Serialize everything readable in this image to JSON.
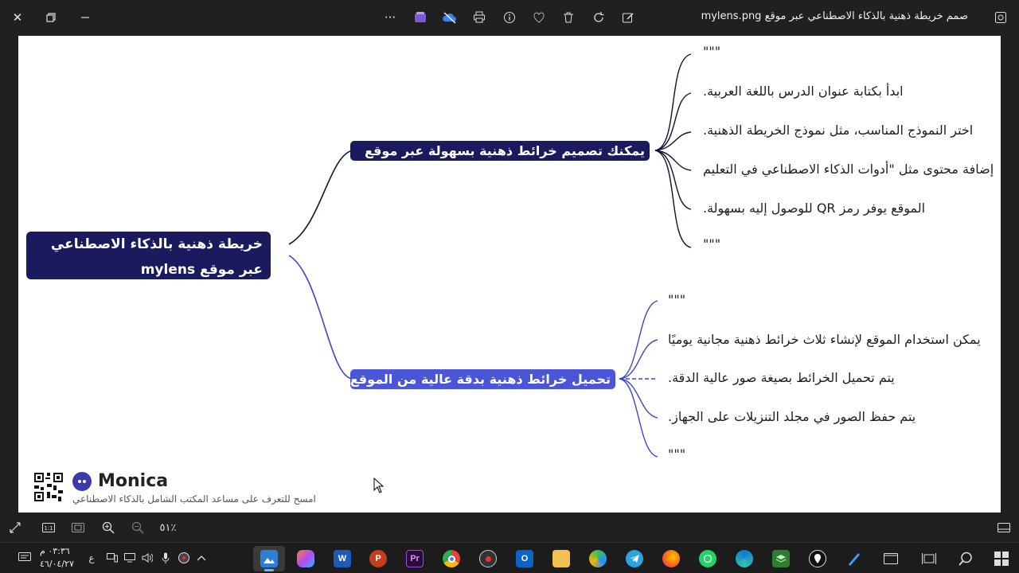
{
  "window": {
    "title": "صمم خريطة ذهنية بالذكاء الاصطناعي عبر موقع mylens.png",
    "more_label": "···"
  },
  "mindmap": {
    "root": "خريطة ذهنية بالذكاء الاصطناعي عبر موقع mylens",
    "branch1": {
      "label": "يمكنك تصميم خرائط ذهنية بسهولة عبر موقع",
      "leaves": [
        "\"\"\"",
        "ابدأ بكتابة عنوان الدرس باللغة العربية.",
        "اختر النموذج المناسب، مثل نموذج الخريطة الذهنية.",
        "إضافة محتوى مثل \"أدوات الذكاء الاصطناعي في التعليم",
        "الموقع يوفر رمز QR للوصول إليه بسهولة.",
        "\"\"\""
      ]
    },
    "branch2": {
      "label": "تحميل خرائط ذهنية بدقة عالية من الموقع",
      "leaves": [
        "\"\"\"",
        "يمكن استخدام الموقع لإنشاء ثلاث خرائط ذهنية مجانية يوميًا",
        "يتم تحميل الخرائط بصيغة صور عالية الدقة.",
        "يتم حفظ الصور في مجلد التنزيلات على الجهاز.",
        "\"\"\""
      ]
    }
  },
  "branding": {
    "name": "Monica",
    "tagline": "امسح للتعرف على مساعد المكتب الشامل بالذكاء الاصطناعي"
  },
  "viewer_toolbar": {
    "zoom_level": "٥١٪"
  },
  "taskbar": {
    "time": "٠٣:٣٦ م",
    "date": "٤٦/٠٤/٢٧",
    "lang": "ع"
  }
}
